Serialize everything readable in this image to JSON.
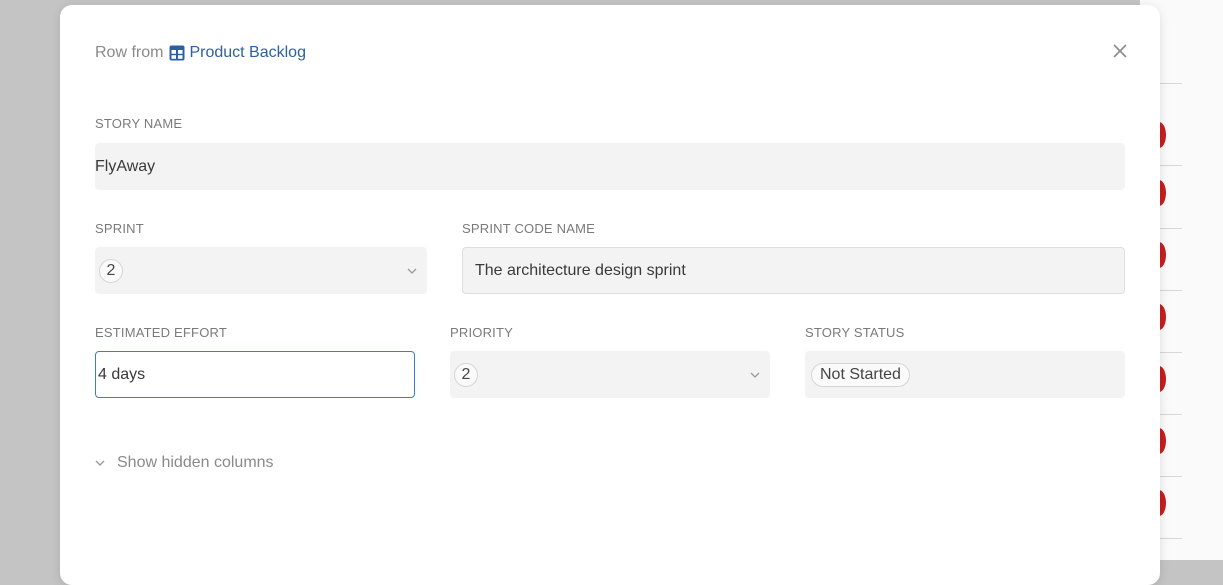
{
  "header": {
    "prefix": "Row from",
    "source_table": "Product Backlog"
  },
  "fields": {
    "story_name": {
      "label": "STORY NAME",
      "value": "FlyAway"
    },
    "sprint": {
      "label": "SPRINT",
      "value": "2"
    },
    "sprint_code_name": {
      "label": "SPRINT CODE NAME",
      "value": "The architecture design sprint"
    },
    "estimated_effort": {
      "label": "ESTIMATED EFFORT",
      "value": "4 days"
    },
    "priority": {
      "label": "PRIORITY",
      "value": "2"
    },
    "story_status": {
      "label": "STORY STATUS",
      "value": "Not Started"
    }
  },
  "show_hidden_columns_label": "Show hidden columns",
  "colors": {
    "accent": "#2d5fa3",
    "focus_border": "#3b7bd4",
    "status_dot": "#c81e1e"
  },
  "icons": {
    "table": "table-icon",
    "close": "close-icon",
    "chevron": "chevron-down-icon"
  }
}
